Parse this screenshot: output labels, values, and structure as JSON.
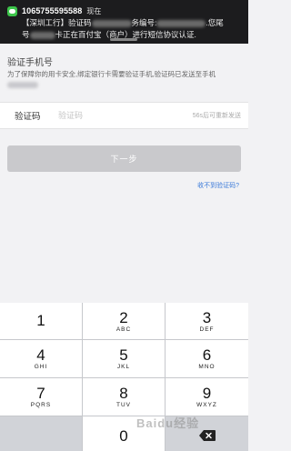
{
  "notification": {
    "sender": "1065755595588",
    "time": "现在",
    "line1_start": "【深圳工行】验证码",
    "line1_mid": "务编号:",
    "line1_end": ".您尾",
    "line2_start": "号",
    "line2_mid": "卡正在百付宝（商户）进行短信协议认证."
  },
  "page": {
    "section_title": "验证手机号",
    "description": "为了保障你的用卡安全,绑定银行卡需要验证手机,验证码已发送至手机",
    "code_label": "验证码",
    "code_placeholder": "验证码",
    "countdown": "56s后可重新发送",
    "next_button": "下一步",
    "no_code_link": "收不到验证码?"
  },
  "keypad": {
    "keys": [
      {
        "num": "1",
        "letters": ""
      },
      {
        "num": "2",
        "letters": "ABC"
      },
      {
        "num": "3",
        "letters": "DEF"
      },
      {
        "num": "4",
        "letters": "GHI"
      },
      {
        "num": "5",
        "letters": "JKL"
      },
      {
        "num": "6",
        "letters": "MNO"
      },
      {
        "num": "7",
        "letters": "PQRS"
      },
      {
        "num": "8",
        "letters": "TUV"
      },
      {
        "num": "9",
        "letters": "WXYZ"
      },
      {
        "num": "0",
        "letters": ""
      }
    ]
  },
  "watermark": "Baidu经验",
  "icons": {
    "notification_app": "message-icon",
    "delete": "backspace-icon"
  },
  "colors": {
    "link": "#3b7ad9",
    "button_disabled": "#c9c9cc",
    "notification_bg": "#1c1c1e",
    "message_green": "#3cc54a"
  }
}
